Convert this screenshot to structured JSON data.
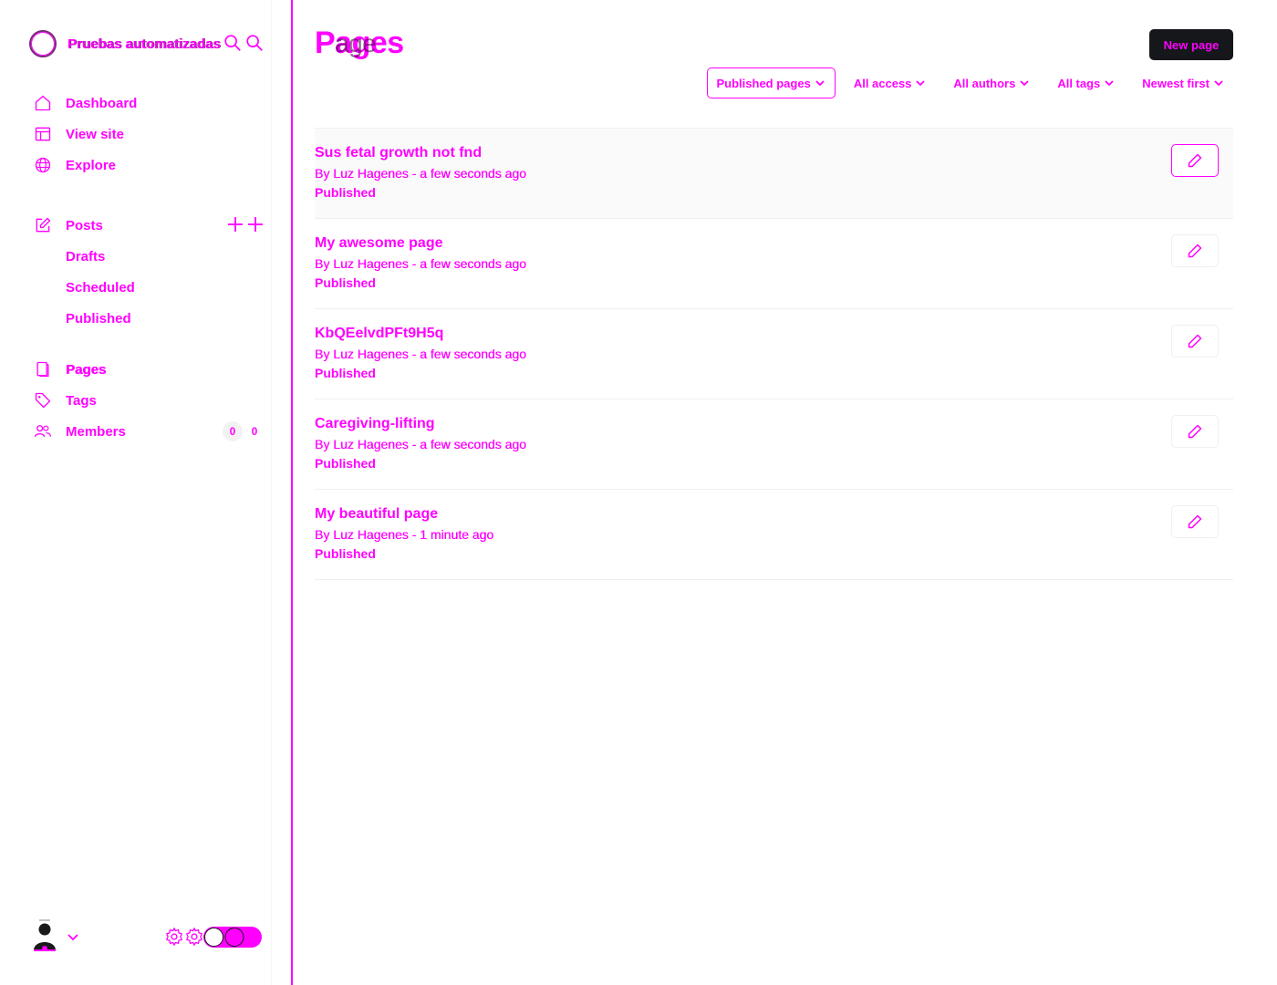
{
  "brand": {
    "name": "Pruebas automatizadas"
  },
  "nav": {
    "main": [
      {
        "label": "Dashboard",
        "icon": "home-icon"
      },
      {
        "label": "View site",
        "icon": "layout-icon"
      },
      {
        "label": "Explore",
        "icon": "globe-icon"
      }
    ],
    "posts": {
      "label": "Posts",
      "icon": "edit-icon"
    },
    "post_subs": [
      "Drafts",
      "Scheduled",
      "Published"
    ],
    "secondary": [
      {
        "label": "Pages",
        "icon": "page-icon"
      },
      {
        "label": "Tags",
        "icon": "tag-icon"
      },
      {
        "label": "Members",
        "icon": "members-icon"
      }
    ],
    "members_count": "0",
    "members_count_dup": "0"
  },
  "header": {
    "title": "Pages",
    "title_ghost": "age",
    "new_button": "New page"
  },
  "filters": [
    {
      "label": "Published pages",
      "selected": true
    },
    {
      "label": "All access",
      "selected": false
    },
    {
      "label": "All authors",
      "selected": false
    },
    {
      "label": "All tags",
      "selected": false
    },
    {
      "label": "Newest first",
      "selected": false
    }
  ],
  "pages": [
    {
      "title": "Sus fetal growth not fnd",
      "meta": "By Luz Hagenes - a few seconds ago",
      "status": "Published"
    },
    {
      "title": "My awesome page",
      "meta": "By Luz Hagenes - a few seconds ago",
      "status": "Published"
    },
    {
      "title": "KbQEelvdPFt9H5q",
      "meta": "By Luz Hagenes - a few seconds ago",
      "status": "Published"
    },
    {
      "title": "Caregiving-lifting",
      "meta": "By Luz Hagenes - a few seconds ago",
      "status": "Published"
    },
    {
      "title": "My beautiful page",
      "meta": "By Luz Hagenes - 1 minute ago",
      "status": "Published"
    }
  ],
  "colors": {
    "accent": "#ff00ff",
    "button_bg": "#15171a"
  }
}
